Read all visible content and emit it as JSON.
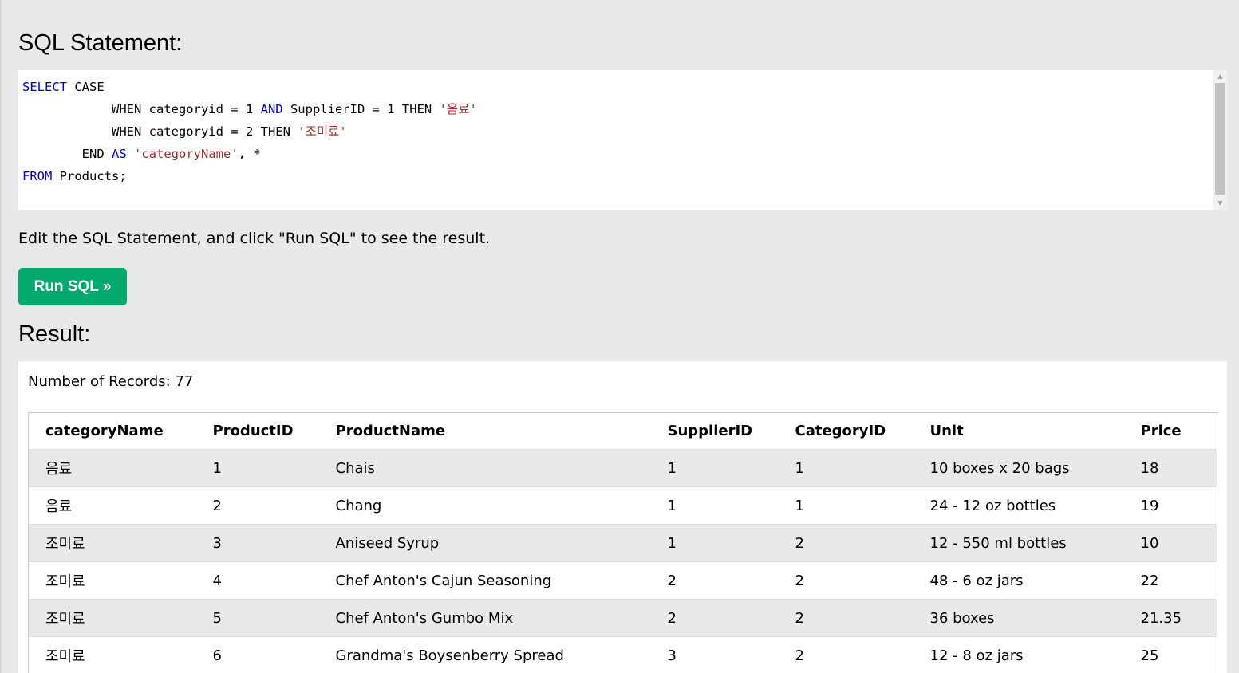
{
  "sql_heading": "SQL Statement:",
  "editor": {
    "lines": [
      [
        {
          "t": "SELECT",
          "c": "kw"
        },
        {
          "t": " CASE",
          "c": ""
        }
      ],
      [
        {
          "t": "            WHEN categoryid = 1 ",
          "c": ""
        },
        {
          "t": "AND",
          "c": "kw"
        },
        {
          "t": " SupplierID = 1 THEN ",
          "c": ""
        },
        {
          "t": "'음료'",
          "c": "str"
        }
      ],
      [
        {
          "t": "            WHEN categoryid = 2 THEN ",
          "c": ""
        },
        {
          "t": "'조미료'",
          "c": "str"
        }
      ],
      [
        {
          "t": "        END ",
          "c": ""
        },
        {
          "t": "AS",
          "c": "kw"
        },
        {
          "t": " ",
          "c": ""
        },
        {
          "t": "'categoryName'",
          "c": "str"
        },
        {
          "t": ", *",
          "c": ""
        }
      ],
      [
        {
          "t": "FROM",
          "c": "kw"
        },
        {
          "t": " Products;",
          "c": ""
        }
      ]
    ]
  },
  "instruction": "Edit the SQL Statement, and click \"Run SQL\" to see the result.",
  "run_button": "Run SQL »",
  "result_heading": "Result:",
  "record_count": "Number of Records: 77",
  "table": {
    "headers": [
      "categoryName",
      "ProductID",
      "ProductName",
      "SupplierID",
      "CategoryID",
      "Unit",
      "Price"
    ],
    "rows": [
      [
        "음료",
        "1",
        "Chais",
        "1",
        "1",
        "10 boxes x 20 bags",
        "18"
      ],
      [
        "음료",
        "2",
        "Chang",
        "1",
        "1",
        "24 - 12 oz bottles",
        "19"
      ],
      [
        "조미료",
        "3",
        "Aniseed Syrup",
        "1",
        "2",
        "12 - 550 ml bottles",
        "10"
      ],
      [
        "조미료",
        "4",
        "Chef Anton's Cajun Seasoning",
        "2",
        "2",
        "48 - 6 oz jars",
        "22"
      ],
      [
        "조미료",
        "5",
        "Chef Anton's Gumbo Mix",
        "2",
        "2",
        "36 boxes",
        "21.35"
      ],
      [
        "조미료",
        "6",
        "Grandma's Boysenberry Spread",
        "3",
        "2",
        "12 - 8 oz jars",
        "25"
      ]
    ]
  },
  "colors": {
    "page_bg": "#e7e9eb",
    "run_button_bg": "#04aa6d",
    "keyword": "#0000cd",
    "string": "#a52a2a"
  }
}
